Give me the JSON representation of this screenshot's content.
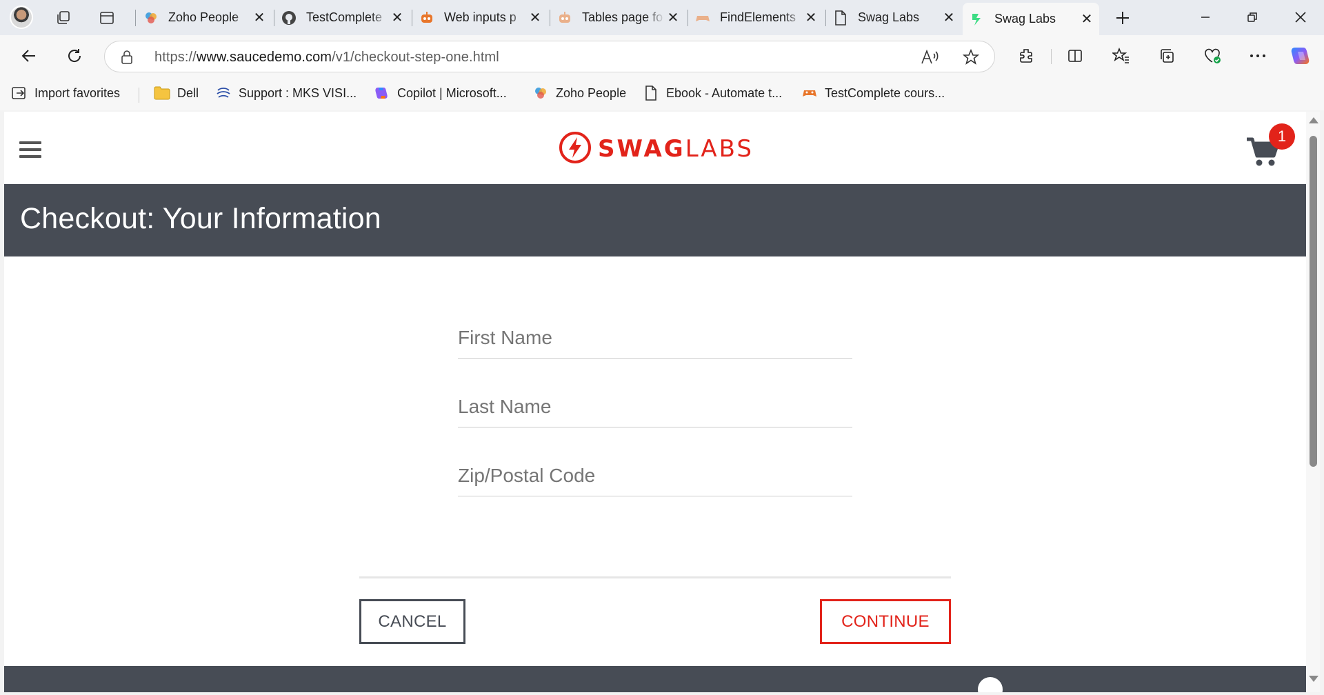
{
  "browser": {
    "tabs": [
      {
        "title": "Zoho People",
        "icon": "zoho-people-icon",
        "active": false
      },
      {
        "title": "TestComplete",
        "icon": "github-icon",
        "active": false
      },
      {
        "title": "Web inputs p",
        "icon": "robot-icon",
        "active": false
      },
      {
        "title": "Tables page fo",
        "icon": "robot-icon",
        "active": false
      },
      {
        "title": "FindElements",
        "icon": "gamepad-icon",
        "active": false
      },
      {
        "title": "Swag Labs",
        "icon": "document-icon",
        "active": false
      },
      {
        "title": "Swag Labs",
        "icon": "swaglabs-icon",
        "active": true
      }
    ],
    "url": {
      "scheme": "https://",
      "host": "www.saucedemo.com",
      "path": "/v1/checkout-step-one.html"
    },
    "bookmarks": [
      {
        "label": "Import favorites",
        "icon": "import-icon"
      },
      {
        "label": "Dell",
        "icon": "folder-icon"
      },
      {
        "label": "Support : MKS VISI...",
        "icon": "globe-icon"
      },
      {
        "label": "Copilot | Microsoft...",
        "icon": "copilot-icon"
      },
      {
        "label": "Zoho People",
        "icon": "zoho-people-icon"
      },
      {
        "label": "Ebook - Automate t...",
        "icon": "document-icon"
      },
      {
        "label": "TestComplete cours...",
        "icon": "gamepad-icon"
      }
    ],
    "colors": {
      "tabstrip": "#e8ebf0",
      "toolbar": "#f7f7f7",
      "accent": "#0078d4"
    }
  },
  "page": {
    "brand": {
      "swag": "SWAG",
      "labs": "LABS",
      "color": "#e2231a"
    },
    "cart": {
      "count": "1"
    },
    "title": "Checkout: Your Information",
    "form": {
      "first_name": {
        "placeholder": "First Name",
        "value": ""
      },
      "last_name": {
        "placeholder": "Last Name",
        "value": ""
      },
      "postal_code": {
        "placeholder": "Zip/Postal Code",
        "value": ""
      }
    },
    "buttons": {
      "cancel": "CANCEL",
      "continue": "CONTINUE"
    },
    "colors": {
      "header_bar": "#474c55",
      "primary": "#e2231a"
    }
  }
}
